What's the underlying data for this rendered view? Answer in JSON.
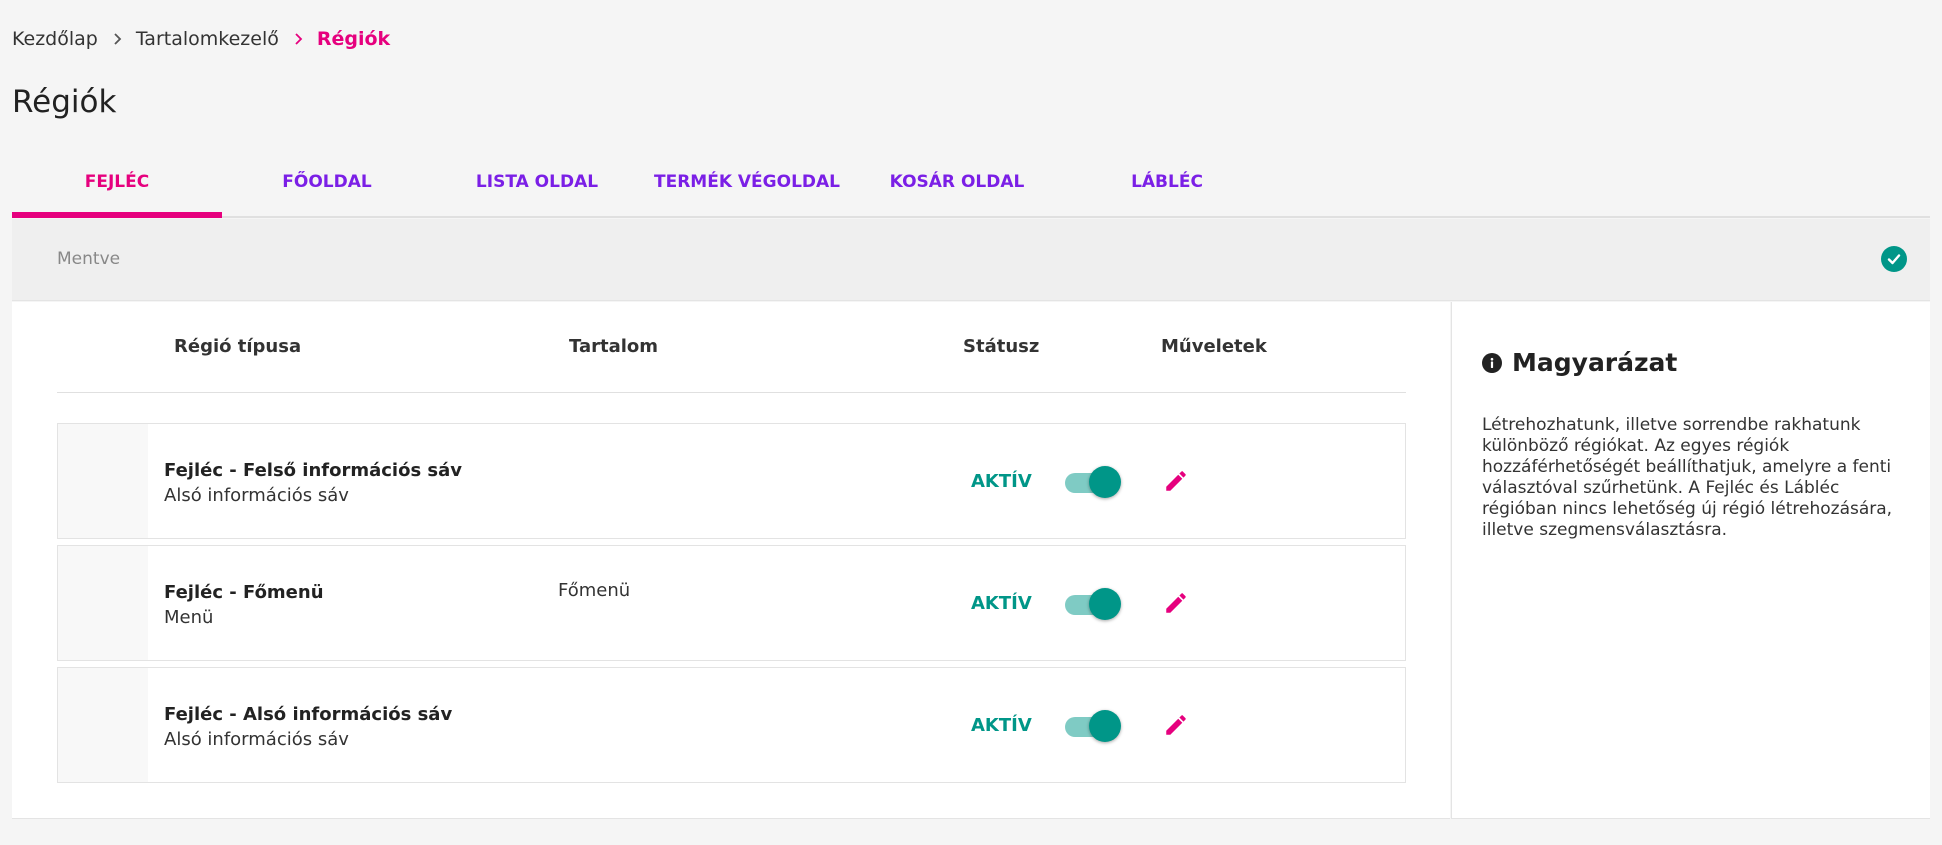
{
  "breadcrumb": {
    "home": "Kezdőlap",
    "section": "Tartalomkezelő",
    "current": "Régiók"
  },
  "page_title": "Régiók",
  "tabs": [
    {
      "label": "FEJLÉC",
      "active": true
    },
    {
      "label": "FŐOLDAL",
      "active": false
    },
    {
      "label": "LISTA OLDAL",
      "active": false
    },
    {
      "label": "TERMÉK VÉGOLDAL",
      "active": false
    },
    {
      "label": "KOSÁR OLDAL",
      "active": false
    },
    {
      "label": "LÁBLÉC",
      "active": false
    }
  ],
  "save_status": {
    "text": "Mentve",
    "icon": "check-circle-icon",
    "color": "#009688"
  },
  "table": {
    "headers": {
      "type": "Régió típusa",
      "content": "Tartalom",
      "status": "Státusz",
      "actions": "Műveletek"
    },
    "rows": [
      {
        "title": "Fejléc - Felső információs sáv",
        "subtitle": "Alsó információs sáv",
        "content": "",
        "status": "AKTÍV",
        "enabled": true
      },
      {
        "title": "Fejléc - Főmenü",
        "subtitle": "Menü",
        "content": "Főmenü",
        "status": "AKTÍV",
        "enabled": true
      },
      {
        "title": "Fejléc - Alsó információs sáv",
        "subtitle": "Alsó információs sáv",
        "content": "",
        "status": "AKTÍV",
        "enabled": true
      }
    ]
  },
  "sidebar": {
    "title": "Magyarázat",
    "icon": "info-icon",
    "text": "Létrehozhatunk, illetve sorrendbe rakhatunk különböző régiókat. Az egyes régiók hozzáférhetőségét beállíthatjuk, amelyre a fenti választóval szűrhetünk. A Fejléc és Lábléc régióban nincs lehetőség új régió létrehozására, illetve szegmensválasztásra."
  },
  "colors": {
    "accent": "#e6007e",
    "tab": "#7b1fe6",
    "active": "#009688"
  }
}
